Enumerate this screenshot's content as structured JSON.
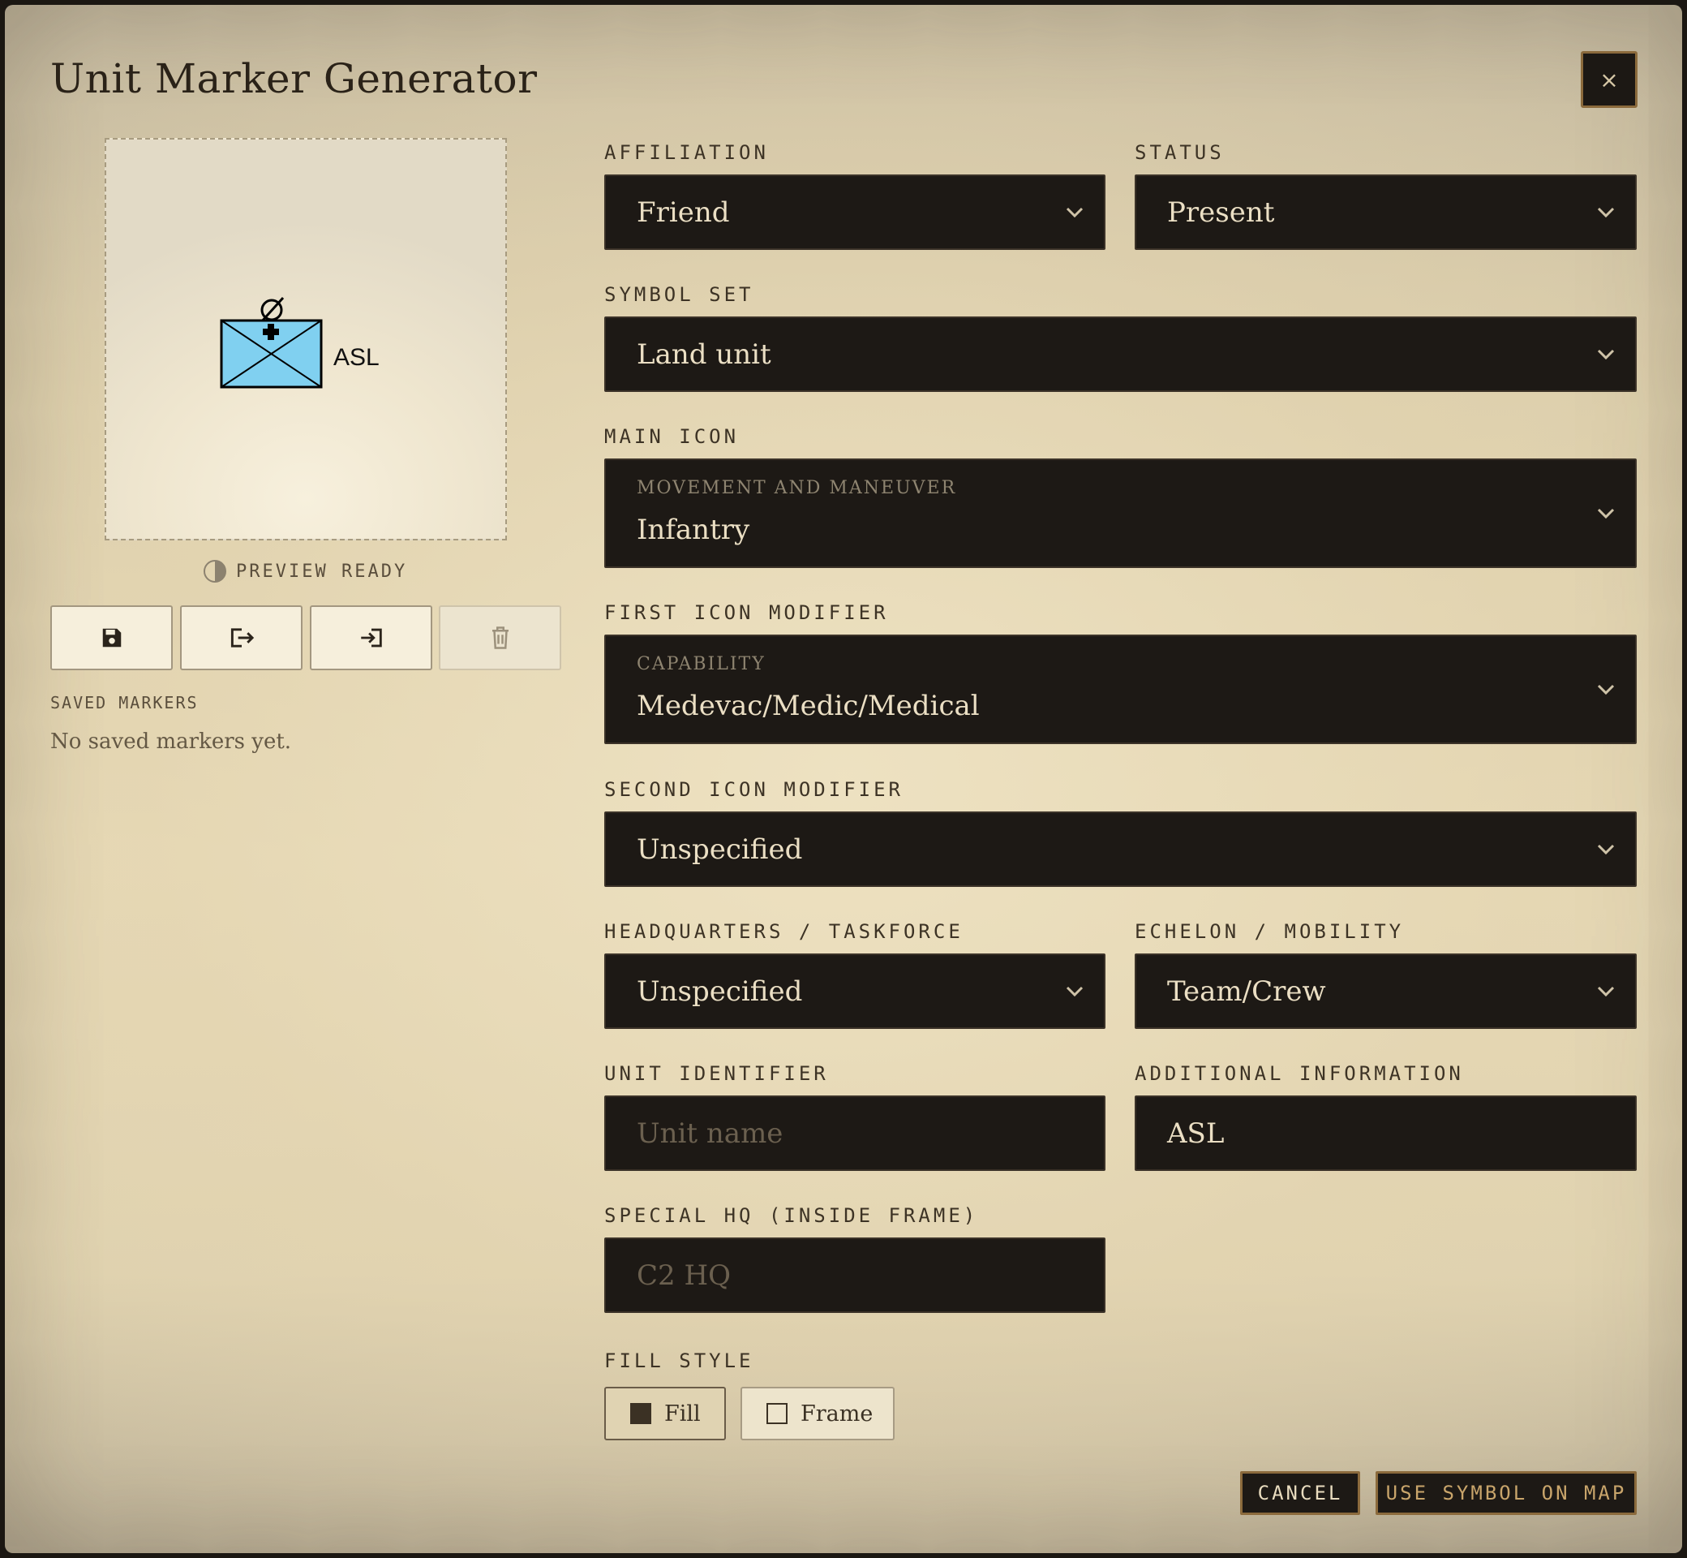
{
  "dialog": {
    "title": "Unit Marker Generator",
    "close_label": "×"
  },
  "preview": {
    "symbol_label": "ASL",
    "frame_color": "#80d0f0",
    "status_text": "PREVIEW READY"
  },
  "toolbar": {
    "icons": [
      "save-icon",
      "export-icon",
      "import-icon",
      "trash-icon"
    ]
  },
  "saved": {
    "label": "SAVED MARKERS",
    "empty_text": "No saved markers yet."
  },
  "form": {
    "affiliation": {
      "label": "Affiliation",
      "value": "Friend"
    },
    "status": {
      "label": "Status",
      "value": "Present"
    },
    "symbol_set": {
      "label": "Symbol Set",
      "value": "Land unit"
    },
    "main_icon": {
      "label": "Main Icon",
      "category": "MOVEMENT AND MANEUVER",
      "value": "Infantry"
    },
    "first_modifier": {
      "label": "First Icon Modifier",
      "category": "CAPABILITY",
      "value": "Medevac/Medic/Medical"
    },
    "second_modifier": {
      "label": "Second Icon Modifier",
      "value": "Unspecified"
    },
    "hq_taskforce": {
      "label": "Headquarters / Taskforce",
      "value": "Unspecified"
    },
    "echelon": {
      "label": "Echelon / Mobility",
      "value": "Team/Crew"
    },
    "unit_identifier": {
      "label": "Unit Identifier",
      "value": "",
      "placeholder": "Unit name"
    },
    "additional_info": {
      "label": "Additional Information",
      "value": "ASL"
    },
    "special_hq": {
      "label": "Special HQ (Inside Frame)",
      "value": "",
      "placeholder": "C2 HQ"
    },
    "fill_style": {
      "label": "Fill Style",
      "options": [
        "Fill",
        "Frame"
      ],
      "selected": "Fill"
    }
  },
  "actions": {
    "cancel": "CANCEL",
    "use": "USE SYMBOL ON MAP"
  }
}
